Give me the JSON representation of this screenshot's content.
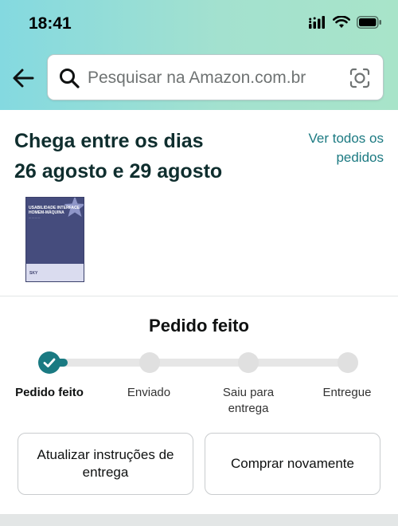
{
  "status_bar": {
    "time": "18:41"
  },
  "search": {
    "placeholder": "Pesquisar na Amazon.com.br"
  },
  "delivery": {
    "line1": "Chega entre os dias",
    "line2": "26 agosto e 29 agosto"
  },
  "orders_link": {
    "line1": "Ver todos os",
    "line2": "pedidos"
  },
  "product": {
    "title_line1": "USABILIDADE INTERFACE",
    "title_line2": "HOMEM-MÁQUINA",
    "publisher": "SKY"
  },
  "order_status": {
    "title": "Pedido feito",
    "steps": [
      {
        "label": "Pedido feito",
        "done": true
      },
      {
        "label": "Enviado",
        "done": false
      },
      {
        "label": "Saiu para entrega",
        "done": false
      },
      {
        "label": "Entregue",
        "done": false
      }
    ],
    "progress_percent": 6
  },
  "actions": {
    "update_instructions": "Atualizar instruções de entrega",
    "buy_again": "Comprar novamente"
  },
  "colors": {
    "accent": "#1a7a82",
    "link": "#1c7a82"
  }
}
